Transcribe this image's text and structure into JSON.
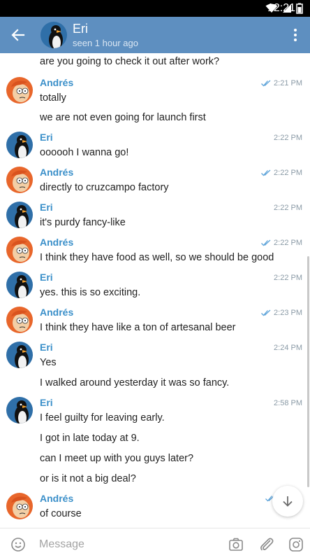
{
  "status_bar": {
    "time": "12:21"
  },
  "header": {
    "title": "Eri",
    "subtitle": "seen 1 hour ago"
  },
  "colors": {
    "header_bg": "#5e8fc0",
    "sender_name": "#3a8fc9",
    "read_ticks": "#5da3d9",
    "time_text": "#8a9aa6"
  },
  "messages": [
    {
      "text": "are you going to check it out after work?"
    },
    {
      "sender": "Andrés",
      "time": "2:21 PM",
      "read": true,
      "text": "totally"
    },
    {
      "text": "we are not even going for launch first"
    },
    {
      "sender": "Eri",
      "time": "2:22 PM",
      "text": "oooooh I wanna go!"
    },
    {
      "sender": "Andrés",
      "time": "2:22 PM",
      "read": true,
      "text": "directly to cruzcampo factory"
    },
    {
      "sender": "Eri",
      "time": "2:22 PM",
      "text": "it's purdy fancy-like"
    },
    {
      "sender": "Andrés",
      "time": "2:22 PM",
      "read": true,
      "text": "I think they have food as well, so we should be good"
    },
    {
      "sender": "Eri",
      "time": "2:22 PM",
      "text": "yes. this is so exciting."
    },
    {
      "sender": "Andrés",
      "time": "2:23 PM",
      "read": true,
      "text": "I think they have like a ton of artesanal beer"
    },
    {
      "sender": "Eri",
      "time": "2:24 PM",
      "text": "Yes"
    },
    {
      "text": "I walked around yesterday it was so fancy."
    },
    {
      "sender": "Eri",
      "time": "2:58 PM",
      "text": "I feel guilty for leaving early."
    },
    {
      "text": "I got in late today at 9."
    },
    {
      "text": "can I meet up with you guys later?"
    },
    {
      "text": "or is it not a big deal?"
    },
    {
      "sender": "Andrés",
      "read": true,
      "text": "of course"
    }
  ],
  "input": {
    "placeholder": "Message",
    "value": ""
  },
  "icons": {
    "back": "arrow-left-icon",
    "menu": "more-vertical-icon",
    "emoji": "smiley-icon",
    "camera": "camera-icon",
    "attach": "paperclip-icon",
    "instagram": "instagram-icon",
    "scroll_down": "arrow-down-icon"
  }
}
